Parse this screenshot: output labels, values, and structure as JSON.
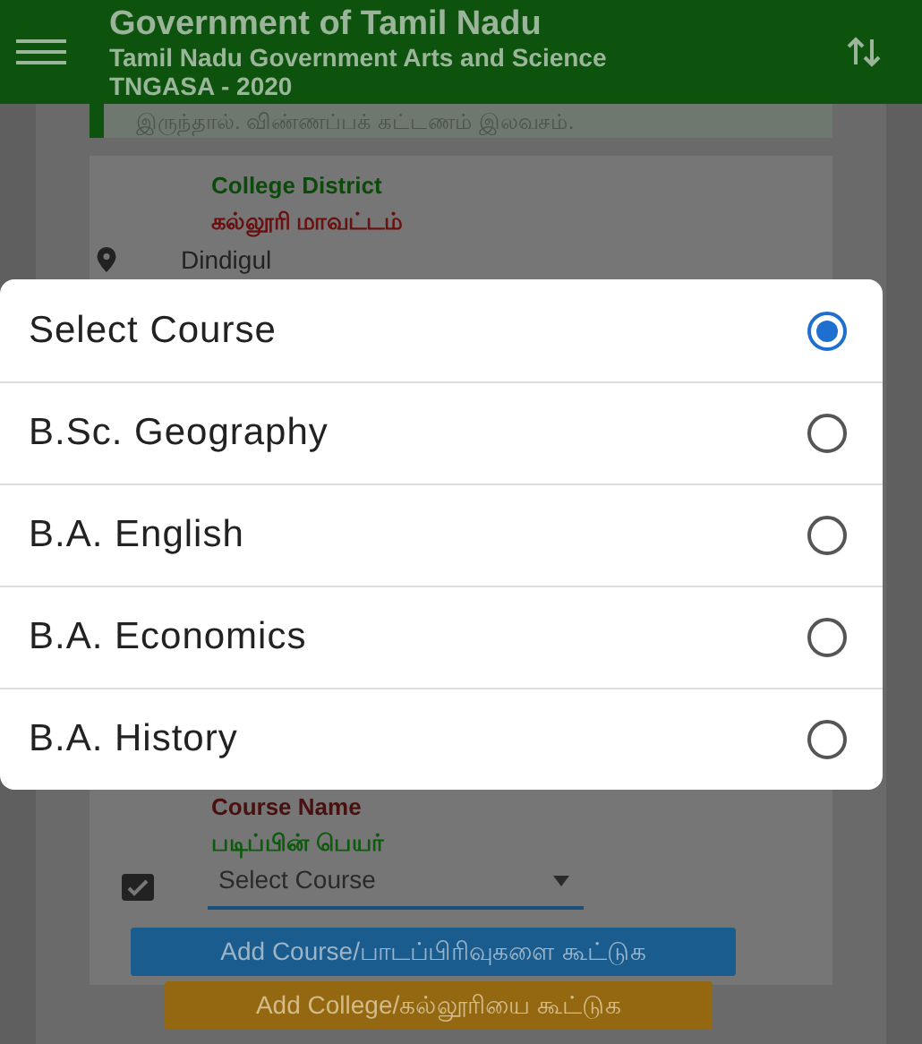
{
  "app_bar": {
    "title": "Government of Tamil Nadu",
    "subtitle": "Tamil Nadu Government Arts and Science",
    "caption": "TNGASA - 2020"
  },
  "notice": "இருந்தால். விண்ணப்பக் கட்டணம் இலவசம்.",
  "district": {
    "label": "College District",
    "label_tamil": "கல்லூரி மாவட்டம்",
    "value": "Dindigul"
  },
  "course": {
    "label": "Course Name",
    "label_tamil": "படிப்பின் பெயர்",
    "value": "Select Course"
  },
  "buttons": [
    {
      "label": "Add Course/பாடப்பிரிவுகளை கூட்டுக",
      "kind": "primary"
    },
    {
      "label": "Add College/கல்லூரியை கூட்டுக",
      "kind": "secondary"
    }
  ],
  "dialog": {
    "options": [
      {
        "label": "Select Course",
        "selected": true
      },
      {
        "label": "B.Sc. Geography",
        "selected": false
      },
      {
        "label": "B.A. English",
        "selected": false
      },
      {
        "label": "B.A. Economics",
        "selected": false
      },
      {
        "label": "B.A. History",
        "selected": false
      }
    ]
  }
}
